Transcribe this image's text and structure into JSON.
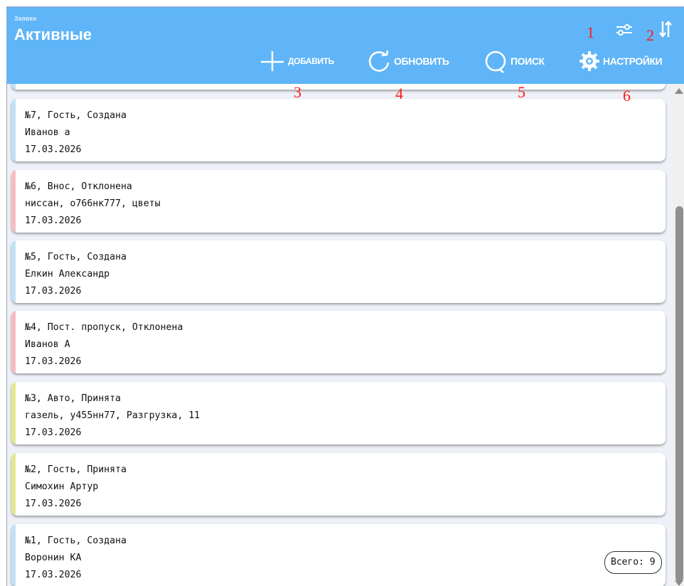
{
  "header": {
    "section": "Заявки",
    "title": "Активные",
    "filter_icon": "filter-sliders-icon",
    "sort_icon": "sort-arrows-icon"
  },
  "toolbar": {
    "add_label": "ДОБАВИТЬ",
    "refresh_label": "ОБНОВИТЬ",
    "search_label": "ПОИСК",
    "settings_label": "НАСТРОЙКИ"
  },
  "annotations": [
    "1",
    "2",
    "3",
    "4",
    "5",
    "6"
  ],
  "cards": [
    {
      "line1": "№7, Гость, Создана",
      "line2": "Иванов а",
      "line3": "17.03.2026",
      "status_color": "#bfe2f7"
    },
    {
      "line1": "№6, Внос, Отклонена",
      "line2": "ниссан, о766нк777, цветы",
      "line3": "17.03.2026",
      "status_color": "#f7bcbf"
    },
    {
      "line1": "№5, Гость, Создана",
      "line2": "Елкин Александр",
      "line3": "17.03.2026",
      "status_color": "#bfe2f7"
    },
    {
      "line1": "№4, Пост. пропуск, Отклонена",
      "line2": "Иванов А",
      "line3": "17.03.2026",
      "status_color": "#f7bcbf"
    },
    {
      "line1": "№3, Авто, Принята",
      "line2": "газель, у455нн77, Разгрузка, 11",
      "line3": "17.03.2026",
      "status_color": "#e3e88f"
    },
    {
      "line1": "№2, Гость, Принята",
      "line2": "Симохин Артур",
      "line3": "17.03.2026",
      "status_color": "#e3e88f"
    },
    {
      "line1": "№1, Гость, Создана",
      "line2": "Воронин КА",
      "line3": "17.03.2026",
      "status_color": "#bfe2f7"
    }
  ],
  "total": "Всего: 9",
  "colors": {
    "header": "#5fb5f7",
    "annotation": "#ff1a1a"
  }
}
